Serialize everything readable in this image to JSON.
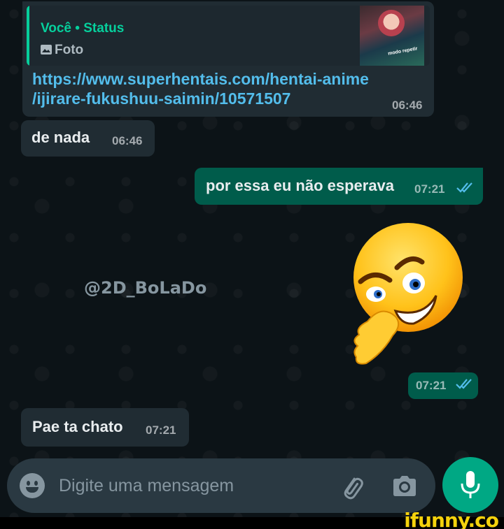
{
  "chat": {
    "reply_message": {
      "quote_author": "Você • Status",
      "quote_type": "Foto",
      "thumbnail_caption": "modo repetir",
      "link_line1": "https://www.superhentais.com/hentai-anime",
      "link_line2": "/ijirare-fukushuu-saimin/10571507",
      "time": "06:46"
    },
    "incoming_1": {
      "text": "de nada",
      "time": "06:46"
    },
    "outgoing_1": {
      "text": "por essa eu não esperava",
      "time": "07:21",
      "status": "read"
    },
    "sticker": {
      "emoji": "smirking-hand-on-chin-emoji",
      "time": "07:21",
      "status": "read"
    },
    "incoming_2": {
      "text": "Pae ta chato",
      "time": "07:21"
    },
    "watermark": "@2D_BoLaDo"
  },
  "input_bar": {
    "placeholder": "Digite uma mensagem",
    "value": ""
  },
  "icons": [
    "emoji-icon",
    "attach-icon",
    "camera-icon",
    "mic-icon",
    "photo-icon",
    "double-check-icon"
  ],
  "colors": {
    "incoming_bubble": "#202c33",
    "outgoing_bubble": "#005c4b",
    "accent": "#00a884",
    "link": "#53bdeb",
    "read_ticks": "#53bdeb"
  },
  "site_watermark": "ifunny.co"
}
